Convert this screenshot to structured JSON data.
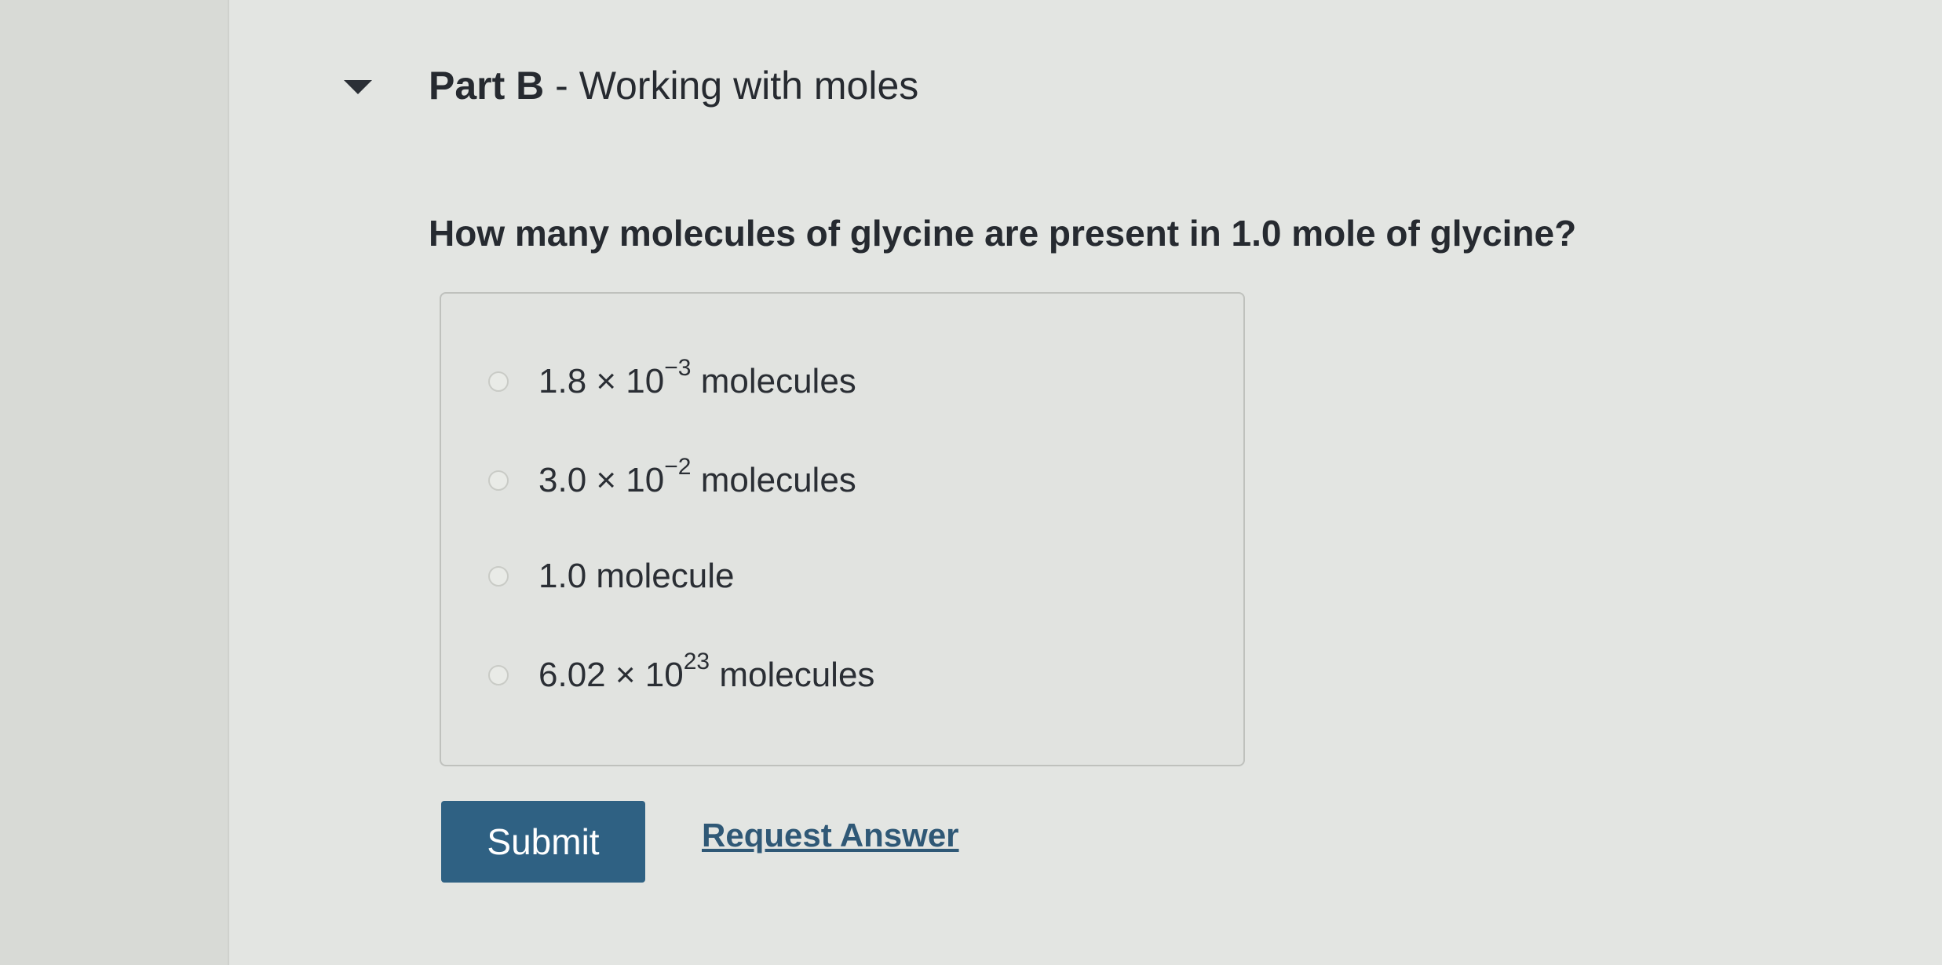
{
  "part": {
    "label": "Part B",
    "separator": " - ",
    "title": "Working with moles"
  },
  "question": "How many molecules of glycine are present in 1.0 mole of glycine?",
  "options": [
    {
      "base": "1.8 × 10",
      "exponent": "−3",
      "unit": " molecules"
    },
    {
      "base": "3.0 × 10",
      "exponent": "−2",
      "unit": " molecules"
    },
    {
      "base": "1.0 molecule",
      "exponent": "",
      "unit": ""
    },
    {
      "base": "6.02 × 10",
      "exponent": "23",
      "unit": " molecules"
    }
  ],
  "actions": {
    "submit_label": "Submit",
    "request_answer_label": "Request Answer"
  },
  "colors": {
    "submit_bg": "#2f6183",
    "link": "#2f5876"
  },
  "icons": {
    "collapse": "caret-down-icon"
  }
}
